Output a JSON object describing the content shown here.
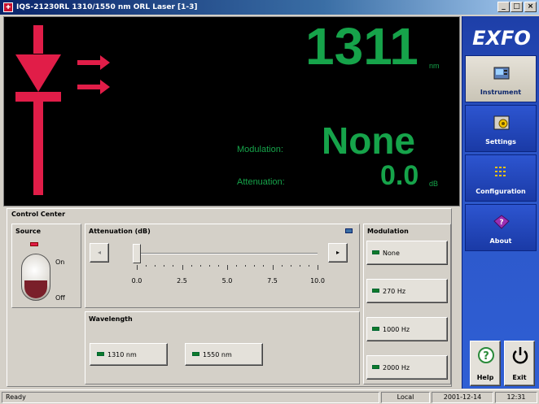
{
  "window": {
    "title": "IQS-21230RL 1310/1550 nm ORL Laser [1-3]",
    "app_icon": "laser-app-icon",
    "controls": [
      "_",
      "□",
      "×"
    ]
  },
  "display": {
    "wavelength_value": "1311",
    "wavelength_unit": "nm",
    "modulation_label": "Modulation:",
    "modulation_value": "None",
    "attenuation_label": "Attenuation:",
    "attenuation_value": "0.0",
    "attenuation_unit": "dB",
    "colors": {
      "value": "#16a34a",
      "laser": "#e11d48",
      "background": "#000000"
    }
  },
  "sidebar": {
    "logo": "EXFO",
    "items": [
      {
        "label": "Instrument",
        "icon": "instrument-icon",
        "active": true
      },
      {
        "label": "Settings",
        "icon": "settings-icon",
        "active": false
      },
      {
        "label": "Configuration",
        "icon": "configuration-icon",
        "active": false
      },
      {
        "label": "About",
        "icon": "about-icon",
        "active": false
      }
    ],
    "help_label": "Help",
    "exit_label": "Exit"
  },
  "control_center": {
    "title": "Control Center",
    "source": {
      "title": "Source",
      "on_label": "On",
      "off_label": "Off"
    },
    "attenuation": {
      "title": "Attenuation (dB)",
      "value": 0.0,
      "min": 0,
      "max": 10,
      "tick_labels": [
        "0.0",
        "2.5",
        "5.0",
        "7.5",
        "10.0"
      ]
    },
    "wavelength": {
      "title": "Wavelength",
      "options": [
        "1310 nm",
        "1550 nm"
      ]
    },
    "modulation": {
      "title": "Modulation",
      "options": [
        "None",
        "270 Hz",
        "1000 Hz",
        "2000 Hz"
      ]
    }
  },
  "statusbar": {
    "status": "Ready",
    "mode": "Local",
    "date": "2001-12-14",
    "time": "12:31"
  }
}
